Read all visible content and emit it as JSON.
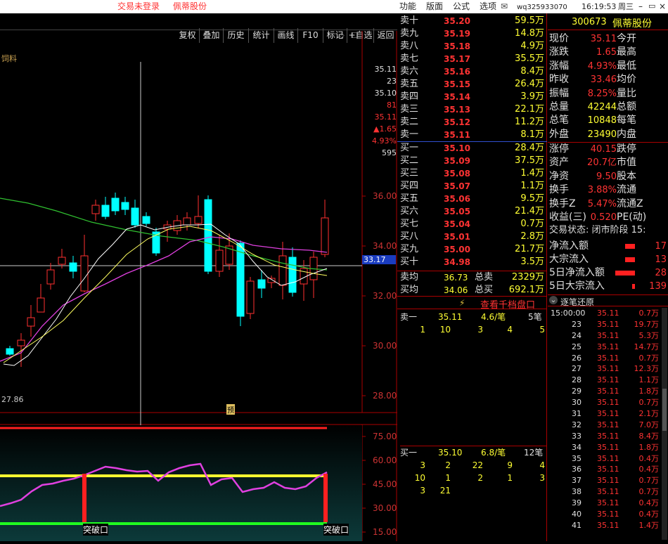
{
  "topbar": {
    "status": "交易未登录",
    "stock_name": "佩蒂股份",
    "menus": [
      "功能",
      "版面",
      "公式",
      "选项"
    ],
    "user": "wq325933070",
    "time": "16:19:53",
    "weekday": "周三"
  },
  "toolbar": [
    "复权",
    "叠加",
    "历史",
    "统计",
    "画线",
    "F10",
    "标记",
    "+自选",
    "返回"
  ],
  "chart": {
    "label": "饲料",
    "price_axis": [
      "36.00",
      "34.00",
      "32.00",
      "30.00",
      "28.00"
    ],
    "low_label": "27.86",
    "side_quotes": [
      "35.11",
      "23",
      "35.10",
      "81",
      "35.11",
      "▲1.65",
      "4.93%",
      "595"
    ],
    "crosshair_value": "33.17",
    "marker": "预"
  },
  "indicator": {
    "axis": [
      "75.00",
      "60.00",
      "45.00",
      "30.00",
      "15.00"
    ],
    "breakout_left": "突破口",
    "breakout_right": "突破口"
  },
  "orderbook": {
    "asks": [
      [
        "卖十",
        "35.20",
        "59.5万"
      ],
      [
        "卖九",
        "35.19",
        "14.8万"
      ],
      [
        "卖八",
        "35.18",
        "4.9万"
      ],
      [
        "卖七",
        "35.17",
        "35.5万"
      ],
      [
        "卖六",
        "35.16",
        "8.4万"
      ],
      [
        "卖五",
        "35.15",
        "26.4万"
      ],
      [
        "卖四",
        "35.14",
        "3.9万"
      ],
      [
        "卖三",
        "35.13",
        "22.1万"
      ],
      [
        "卖二",
        "35.12",
        "11.2万"
      ],
      [
        "卖一",
        "35.11",
        "8.1万"
      ]
    ],
    "bids": [
      [
        "买一",
        "35.10",
        "28.4万"
      ],
      [
        "买二",
        "35.09",
        "37.5万"
      ],
      [
        "买三",
        "35.08",
        "1.4万"
      ],
      [
        "买四",
        "35.07",
        "1.1万"
      ],
      [
        "买五",
        "35.06",
        "9.5万"
      ],
      [
        "买六",
        "35.05",
        "21.4万"
      ],
      [
        "买七",
        "35.04",
        "0.7万"
      ],
      [
        "买八",
        "35.01",
        "2.8万"
      ],
      [
        "买九",
        "35.00",
        "21.7万"
      ],
      [
        "买十",
        "34.98",
        "3.5万"
      ]
    ],
    "avg": [
      [
        "卖均",
        "36.73",
        "总卖",
        "2329万"
      ],
      [
        "买均",
        "34.06",
        "总买",
        "692.1万"
      ]
    ],
    "depth_link": "查看千档盘口",
    "ask1": {
      "label": "卖一",
      "price": "35.11",
      "per": "4.6/笔",
      "count": "5笔",
      "orders": [
        "1",
        "10",
        "3",
        "4",
        "5"
      ]
    },
    "bid1": {
      "label": "买一",
      "price": "35.10",
      "per": "6.8/笔",
      "count": "12笔",
      "orders": [
        [
          "3",
          "2",
          "22",
          "9",
          "4"
        ],
        [
          "10",
          "1",
          "2",
          "1",
          "3"
        ],
        [
          "3",
          "21",
          "",
          "",
          ""
        ]
      ]
    }
  },
  "info": {
    "code": "300673",
    "name": "佩蒂股份",
    "rows": [
      [
        "现价",
        "35.11",
        "今开"
      ],
      [
        "涨跌",
        "1.65",
        "最高"
      ],
      [
        "涨幅",
        "4.93%",
        "最低"
      ],
      [
        "昨收",
        "33.46",
        "均价"
      ],
      [
        "振幅",
        "8.25%",
        "量比"
      ],
      [
        "总量",
        "42244",
        "总额"
      ],
      [
        "总笔",
        "10848",
        "每笔"
      ],
      [
        "外盘",
        "23490",
        "内盘"
      ]
    ],
    "rows2": [
      [
        "涨停",
        "40.15",
        "跌停"
      ],
      [
        "资产",
        "20.7亿",
        "市值"
      ],
      [
        "净资",
        "9.50",
        "股本"
      ],
      [
        "换手",
        "3.88%",
        "流通"
      ],
      [
        "换手Z",
        "5.47%",
        "流通Z"
      ],
      [
        "收益(三)",
        "0.520",
        "PE(动)"
      ]
    ],
    "trade_state": "交易状态: 闭市阶段 15:",
    "flows": [
      [
        "净流入额",
        "17"
      ],
      [
        "大宗流入",
        "13"
      ],
      [
        "5日净流入额",
        "28"
      ],
      [
        "5日大宗流入",
        "139"
      ]
    ],
    "ticks_title": "逐笔还原",
    "ticks": [
      [
        "15:00:00",
        "35.11",
        "0.7万"
      ],
      [
        "23",
        "35.11",
        "19.7万"
      ],
      [
        "24",
        "35.11",
        "5.3万"
      ],
      [
        "25",
        "35.11",
        "14.7万"
      ],
      [
        "26",
        "35.11",
        "0.7万"
      ],
      [
        "27",
        "35.11",
        "12.3万"
      ],
      [
        "28",
        "35.11",
        "1.1万"
      ],
      [
        "29",
        "35.11",
        "1.8万"
      ],
      [
        "30",
        "35.11",
        "0.7万"
      ],
      [
        "31",
        "35.11",
        "2.1万"
      ],
      [
        "32",
        "35.11",
        "7.0万"
      ],
      [
        "33",
        "35.11",
        "8.4万"
      ],
      [
        "34",
        "35.11",
        "1.8万"
      ],
      [
        "35",
        "35.11",
        "0.4万"
      ],
      [
        "36",
        "35.11",
        "0.4万"
      ],
      [
        "37",
        "35.11",
        "0.7万"
      ],
      [
        "38",
        "35.11",
        "0.7万"
      ],
      [
        "39",
        "35.11",
        "0.4万"
      ],
      [
        "40",
        "35.11",
        "0.4万"
      ],
      [
        "41",
        "35.11",
        "1.4万"
      ]
    ]
  }
}
